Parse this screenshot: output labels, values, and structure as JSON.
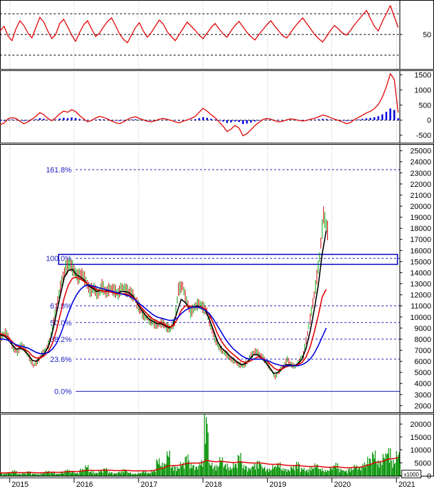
{
  "colors": {
    "price_up": "#00a000",
    "price_down": "#d00000",
    "ma_short": "#000000",
    "ma_mid": "#e00000",
    "ma_long": "#0000e0",
    "rsi": "#e00000",
    "osc_line": "#e00000",
    "osc_hist": "#0000e0",
    "fib": "#2020c0",
    "resistance_box": "#0000c0",
    "volume": "#009000",
    "volume_ma": "#e00000",
    "grid": "#000000",
    "axis_text": "#000000"
  },
  "chart_data": [
    {
      "type": "line",
      "panel": "rsi",
      "y_ticks": [
        "50"
      ],
      "ylim": [
        0,
        100
      ],
      "reference_lines": [
        20,
        50,
        80
      ],
      "series": [
        {
          "values": [
            55,
            62,
            48,
            41,
            58,
            70,
            63,
            52,
            45,
            60,
            75,
            68,
            55,
            44,
            50,
            66,
            72,
            61,
            49,
            40,
            53,
            64,
            70,
            58,
            47,
            52,
            61,
            69,
            74,
            63,
            51,
            43,
            38,
            49,
            60,
            67,
            55,
            46,
            53,
            62,
            71,
            65,
            54,
            47,
            41,
            50,
            59,
            68,
            62,
            56,
            49,
            44,
            52,
            60,
            66,
            58,
            51,
            46,
            55,
            63,
            69,
            61,
            53,
            47,
            42,
            50,
            57,
            64,
            70,
            62,
            55,
            48,
            45,
            53,
            61,
            68,
            74,
            66,
            58,
            50,
            44,
            39,
            47,
            56,
            63,
            58,
            52,
            49,
            56,
            64,
            71,
            78,
            85,
            73,
            62,
            55,
            69,
            80,
            92,
            76,
            60
          ]
        }
      ]
    },
    {
      "type": "line",
      "panel": "oscillator",
      "y_ticks": [
        "1500",
        "1000",
        "500",
        "0",
        "-500"
      ],
      "ylim": [
        -750,
        1650
      ],
      "series": [
        {
          "values": [
            -150,
            -100,
            40,
            80,
            60,
            -40,
            -120,
            -60,
            30,
            120,
            250,
            180,
            60,
            -20,
            80,
            210,
            300,
            260,
            350,
            280,
            150,
            40,
            -60,
            -10,
            70,
            120,
            90,
            40,
            -30,
            -80,
            -120,
            -60,
            20,
            80,
            110,
            60,
            10,
            -40,
            -60,
            -20,
            30,
            60,
            20,
            -10,
            -60,
            -90,
            -40,
            10,
            60,
            120,
            260,
            390,
            300,
            180,
            80,
            -60,
            -200,
            -380,
            -300,
            -180,
            -260,
            -520,
            -450,
            -320,
            -180,
            -80,
            20,
            60,
            30,
            -20,
            -60,
            -40,
            10,
            40,
            20,
            -10,
            -30,
            -10,
            30,
            60,
            110,
            170,
            140,
            80,
            30,
            -10,
            -60,
            -120,
            -80,
            20,
            90,
            160,
            240,
            290,
            380,
            520,
            760,
            1100,
            1540,
            1350,
            250
          ]
        }
      ]
    },
    {
      "type": "line",
      "panel": "price",
      "title": "",
      "y_ticks": [
        "25000",
        "24000",
        "23000",
        "22000",
        "21000",
        "20000",
        "19000",
        "18000",
        "17000",
        "16000",
        "15000",
        "14000",
        "13000",
        "12000",
        "11000",
        "10000",
        "9000",
        "8000",
        "7000",
        "6000",
        "5000",
        "4000",
        "3000",
        "2000"
      ],
      "ylim": [
        1400,
        25600
      ],
      "x_ticks": [
        "2015",
        "2016",
        "2017",
        "2018",
        "2019",
        "2020",
        "2021"
      ],
      "x_tick_positions": [
        0.5,
        1.5,
        2.5,
        3.5,
        4.5,
        5.5,
        6.5
      ],
      "xlim": [
        0.35,
        6.55
      ],
      "fibonacci": [
        {
          "label": "161.8%",
          "value": 23300
        },
        {
          "label": "100.0%",
          "value": 15300
        },
        {
          "label": "61.8%",
          "value": 11000
        },
        {
          "label": "50.0%",
          "value": 9500
        },
        {
          "label": "38.2%",
          "value": 8000
        },
        {
          "label": "23.6%",
          "value": 6200
        },
        {
          "label": "0.0%",
          "value": 3300
        }
      ],
      "resistance_zone": {
        "x_from": 1.26,
        "x_to": 6.52,
        "low": 14750,
        "high": 15650
      },
      "price_x_start": 0.35,
      "price_x_step": 0.0625,
      "series": [
        {
          "name": "",
          "role": "close",
          "values": [
            8200,
            8600,
            8000,
            7200,
            6800,
            7600,
            7000,
            6300,
            5600,
            6000,
            6600,
            7000,
            7800,
            9500,
            11500,
            13200,
            14400,
            14800,
            14200,
            13600,
            13900,
            13200,
            12400,
            12600,
            12000,
            12800,
            12200,
            12600,
            12400,
            12100,
            12700,
            12400,
            12200,
            11800,
            11000,
            10300,
            10000,
            9700,
            9400,
            9300,
            9500,
            9100,
            8900,
            9600,
            12500,
            12800,
            11400,
            10400,
            10900,
            11200,
            10900,
            10500,
            9200,
            8100,
            7300,
            6900,
            6600,
            6200,
            6000,
            5700,
            5600,
            5900,
            6500,
            6900,
            6700,
            6300,
            5800,
            5200,
            4600,
            5100,
            5600,
            6200,
            5700,
            5500,
            6000,
            6600,
            8500,
            10500,
            12700,
            15400,
            19200,
            17800
          ]
        },
        {
          "name": "",
          "role": "ma_short",
          "values": [
            8400,
            8300,
            8000,
            7500,
            7100,
            7200,
            7000,
            6600,
            6100,
            6000,
            6300,
            6700,
            7300,
            8600,
            10300,
            12000,
            13600,
            14200,
            14300,
            13800,
            13600,
            13300,
            12800,
            12600,
            12300,
            12400,
            12300,
            12400,
            12300,
            12100,
            12300,
            12300,
            12200,
            11900,
            11300,
            10700,
            10200,
            9800,
            9600,
            9400,
            9400,
            9200,
            9000,
            9300,
            10500,
            11600,
            11300,
            10800,
            10900,
            11000,
            10900,
            10600,
            9800,
            8800,
            7800,
            7200,
            6900,
            6500,
            6200,
            5900,
            5700,
            5800,
            6200,
            6600,
            6600,
            6300,
            5900,
            5400,
            4900,
            5000,
            5300,
            5700,
            5700,
            5600,
            5800,
            6200,
            7200,
            8700,
            10600,
            12800,
            15700,
            17800
          ]
        },
        {
          "name": "",
          "role": "ma_mid",
          "values": [
            8500,
            8400,
            8200,
            7800,
            7400,
            7300,
            7100,
            6900,
            6500,
            6300,
            6300,
            6500,
            6900,
            7600,
            8800,
            10300,
            11800,
            12900,
            13500,
            13600,
            13400,
            13200,
            12900,
            12700,
            12500,
            12400,
            12300,
            12300,
            12200,
            12100,
            12100,
            12100,
            12000,
            11800,
            11400,
            10900,
            10500,
            10100,
            9800,
            9600,
            9500,
            9300,
            9100,
            9200,
            9800,
            10600,
            11000,
            11000,
            10900,
            10900,
            10900,
            10700,
            10200,
            9400,
            8500,
            7800,
            7300,
            6900,
            6600,
            6300,
            6000,
            5900,
            6000,
            6200,
            6400,
            6300,
            6100,
            5800,
            5400,
            5200,
            5300,
            5500,
            5600,
            5600,
            5700,
            5900,
            6400,
            7300,
            8600,
            10100,
            11800,
            12500
          ]
        },
        {
          "name": "",
          "role": "ma_long",
          "values": [
            8000,
            8000,
            7900,
            7700,
            7500,
            7400,
            7300,
            7200,
            7000,
            6800,
            6700,
            6700,
            6800,
            7100,
            7600,
            8400,
            9400,
            10400,
            11300,
            12000,
            12500,
            12800,
            12900,
            12800,
            12700,
            12600,
            12500,
            12400,
            12300,
            12200,
            12100,
            12000,
            11900,
            11700,
            11400,
            11100,
            10800,
            10500,
            10200,
            10000,
            9900,
            9800,
            9700,
            9700,
            9900,
            10300,
            10600,
            10800,
            10900,
            10900,
            10800,
            10600,
            10300,
            9800,
            9200,
            8600,
            8000,
            7500,
            7100,
            6800,
            6500,
            6300,
            6200,
            6200,
            6200,
            6200,
            6100,
            6000,
            5800,
            5700,
            5600,
            5600,
            5600,
            5600,
            5600,
            5700,
            5900,
            6200,
            6700,
            7400,
            8200,
            9000
          ]
        }
      ]
    },
    {
      "type": "bar",
      "panel": "volume",
      "y_ticks": [
        "20000",
        "15000",
        "10000",
        "5000",
        "0"
      ],
      "ylim": [
        0,
        24000
      ],
      "units_label": "x1000",
      "series": [
        {
          "values": [
            1200,
            900,
            1500,
            2200,
            800,
            1100,
            1800,
            900,
            700,
            1300,
            2000,
            1600,
            900,
            1400,
            2500,
            1800,
            1200,
            2800,
            4200,
            1900,
            1300,
            2200,
            3100,
            1500,
            1100,
            1700,
            2600,
            1400,
            900,
            1200,
            1900,
            1300,
            2300,
            6800,
            5200,
            9800,
            4100,
            3600,
            5400,
            8300,
            4600,
            3900,
            6100,
            24000,
            5200,
            4300,
            7400,
            4800,
            3500,
            5100,
            8800,
            4200,
            3300,
            4700,
            6000,
            3600,
            2900,
            4100,
            5300,
            3000,
            2600,
            3800,
            5500,
            3200,
            2500,
            3600,
            4800,
            2900,
            2300,
            3400,
            5100,
            2800,
            2200,
            3100,
            4300,
            3600,
            5200,
            7400,
            9800,
            6100,
            8800,
            11000,
            6200,
            9600
          ]
        },
        {
          "role": "volume_ma",
          "values": [
            1100,
            1100,
            1200,
            1300,
            1200,
            1200,
            1300,
            1200,
            1100,
            1200,
            1300,
            1400,
            1300,
            1400,
            1600,
            1700,
            1600,
            1800,
            2100,
            2100,
            2000,
            2100,
            2200,
            2100,
            2000,
            2000,
            2100,
            2000,
            1900,
            1900,
            1900,
            1900,
            2000,
            2600,
            3000,
            3800,
            3900,
            4000,
            4300,
            4800,
            4900,
            4900,
            5000,
            6000,
            5600,
            5400,
            5600,
            5400,
            5200,
            5100,
            5400,
            5200,
            5000,
            4900,
            5000,
            4800,
            4500,
            4400,
            4500,
            4200,
            4000,
            3900,
            4000,
            3800,
            3600,
            3600,
            3700,
            3500,
            3300,
            3300,
            3500,
            3300,
            3100,
            3100,
            3300,
            3300,
            3700,
            4300,
            5000,
            5300,
            5700,
            6500,
            6600,
            7100
          ]
        }
      ]
    }
  ]
}
